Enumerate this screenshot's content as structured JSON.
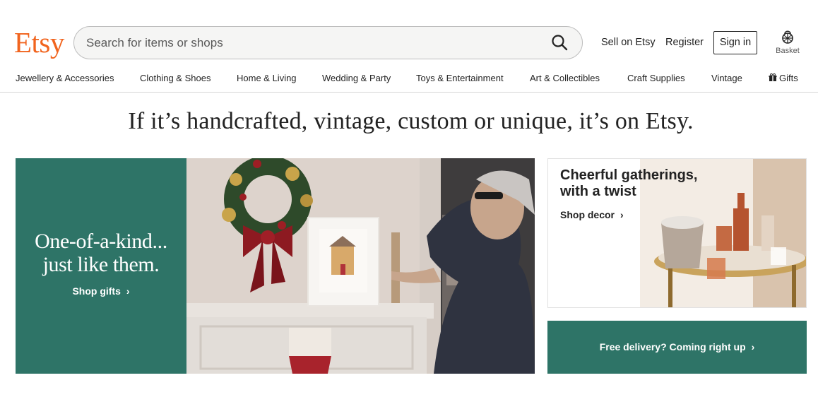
{
  "header": {
    "logo": "Etsy",
    "search_placeholder": "Search for items or shops",
    "sell_link": "Sell on Etsy",
    "register_link": "Register",
    "signin_button": "Sign in",
    "basket_label": "Basket"
  },
  "categories": [
    "Jewellery & Accessories",
    "Clothing & Shoes",
    "Home & Living",
    "Wedding & Party",
    "Toys & Entertainment",
    "Art & Collectibles",
    "Craft Supplies",
    "Vintage",
    "Gifts"
  ],
  "tagline": "If it’s handcrafted, vintage, custom or unique, it’s on Etsy.",
  "hero": {
    "title_line1": "One-of-a-kind...",
    "title_line2": "just like them.",
    "link": "Shop gifts"
  },
  "card_top": {
    "title": "Cheerful gatherings, with a twist",
    "link": "Shop decor"
  },
  "card_bottom": {
    "link": "Free delivery? Coming right up"
  },
  "colors": {
    "brand": "#f1641e",
    "teal": "#2e7467",
    "text": "#222222"
  },
  "icons": [
    "search-icon",
    "basket-icon",
    "gift-icon",
    "chevron-right-icon"
  ]
}
